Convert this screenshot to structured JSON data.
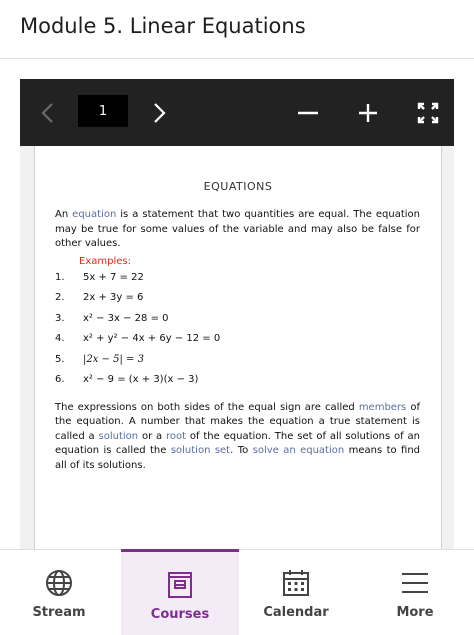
{
  "header": {
    "title": "Module 5. Linear Equations"
  },
  "viewer": {
    "page_number": "1"
  },
  "document": {
    "title": "EQUATIONS",
    "intro": [
      {
        "t": "An "
      },
      {
        "t": "equation",
        "hl": true
      },
      {
        "t": " is a statement that two quantities are equal. The equation may be true for some values of the variable and may also be false for other values."
      }
    ],
    "examples_label": "Examples:",
    "examples": [
      {
        "num": "1.",
        "expr": "5x + 7 = 22"
      },
      {
        "num": "2.",
        "expr": "2x + 3y = 6"
      },
      {
        "num": "3.",
        "expr": "x² − 3x − 28 = 0"
      },
      {
        "num": "4.",
        "expr": "x² + y² − 4x + 6y − 12 = 0"
      },
      {
        "num": "5.",
        "expr": "|2x − 5| = 3",
        "serif": true
      },
      {
        "num": "6.",
        "expr": "x² − 9 = (x + 3)(x − 3)"
      }
    ],
    "body": [
      {
        "t": "The expressions on both sides of the equal sign are called "
      },
      {
        "t": "members",
        "hl": true
      },
      {
        "t": " of the equation. A number that makes the equation a true statement is called a "
      },
      {
        "t": "solution",
        "hl": true
      },
      {
        "t": " or a "
      },
      {
        "t": "root",
        "hl": true
      },
      {
        "t": " of the equation. The set of all solutions of an equation is called the "
      },
      {
        "t": "solution set",
        "hl": true
      },
      {
        "t": ". To "
      },
      {
        "t": "solve an equation",
        "hl": true
      },
      {
        "t": " means to find all of its solutions."
      }
    ]
  },
  "nav": [
    {
      "key": "stream",
      "label": "Stream",
      "icon": "globe-icon"
    },
    {
      "key": "courses",
      "label": "Courses",
      "icon": "courses-icon",
      "active": true
    },
    {
      "key": "calendar",
      "label": "Calendar",
      "icon": "calendar-icon"
    },
    {
      "key": "more",
      "label": "More",
      "icon": "menu-icon"
    }
  ],
  "colors": {
    "accent": "#7c2f8c",
    "toolbar": "#222222",
    "highlight": "#5a6fa0",
    "examples": "#d03020"
  }
}
